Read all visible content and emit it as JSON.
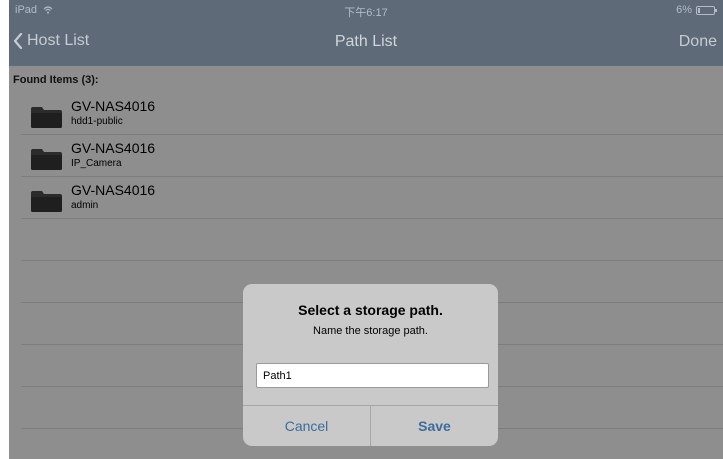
{
  "status_bar": {
    "device": "iPad",
    "time": "下午6:17",
    "battery": "6%",
    "battery_level_percent": 6
  },
  "nav": {
    "back_label": "Host List",
    "title": "Path List",
    "done_label": "Done"
  },
  "list": {
    "header": "Found Items (3):",
    "items": [
      {
        "title": "GV-NAS4016",
        "subtitle": "hdd1-public"
      },
      {
        "title": "GV-NAS4016",
        "subtitle": "IP_Camera"
      },
      {
        "title": "GV-NAS4016",
        "subtitle": "admin"
      }
    ]
  },
  "dialog": {
    "title": "Select a storage path.",
    "message": "Name the storage path.",
    "input_value": "Path1",
    "cancel_label": "Cancel",
    "save_label": "Save"
  },
  "colors": {
    "nav_bar": "#5e6a78",
    "dim_background": "#8e8e8e",
    "dialog_background": "#c9c9c9",
    "button_text": "#3c6c9c",
    "folder_icon": "#2b2b2b"
  }
}
